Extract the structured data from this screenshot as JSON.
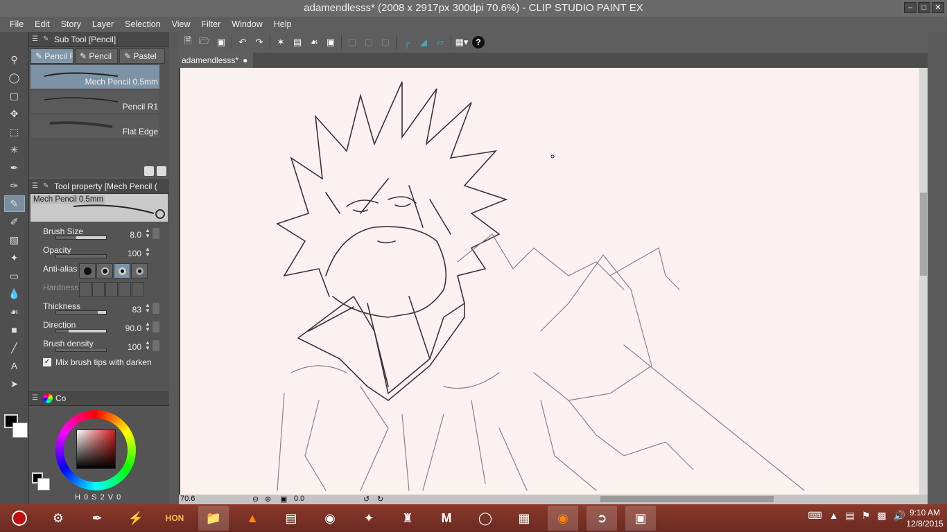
{
  "window": {
    "title": "adamendlesss* (2008 x 2917px 300dpi 70.6%)  - CLIP STUDIO PAINT EX"
  },
  "menu": [
    "File",
    "Edit",
    "Story",
    "Layer",
    "Selection",
    "View",
    "Filter",
    "Window",
    "Help"
  ],
  "subtool": {
    "header": "Sub Tool [Pencil]",
    "tabs": [
      "Pencil F",
      "Pencil",
      "Pastel"
    ],
    "brushes": [
      "Mech Pencil 0.5mm",
      "Pencil R1",
      "Flat Edge"
    ]
  },
  "toolprop": {
    "header": "Tool property [Mech Pencil (",
    "preview_name": "Mech Pencil 0.5mm",
    "brush_size": {
      "label": "Brush Size",
      "value": "8.0",
      "fraction": 0.4
    },
    "opacity": {
      "label": "Opacity",
      "value": "100",
      "fraction": 1.0
    },
    "anti_alias": {
      "label": "Anti-alias"
    },
    "hardness": {
      "label": "Hardness"
    },
    "thickness": {
      "label": "Thickness",
      "value": "83",
      "fraction": 0.83
    },
    "direction": {
      "label": "Direction",
      "value": "90.0",
      "fraction": 0.25
    },
    "brush_density": {
      "label": "Brush density",
      "value": "100",
      "fraction": 1.0
    },
    "mix_tips": {
      "label": "Mix brush tips with darken",
      "checked": true
    }
  },
  "colorpanel": {
    "tab_label": "Co",
    "hsv": {
      "h": "0",
      "s": "2",
      "v": "0"
    }
  },
  "document": {
    "tab": "adamendlesss*"
  },
  "status": {
    "zoom": "70.6",
    "rotation": "0.0"
  },
  "taskbar": {
    "apps": [
      "power-icon",
      "settings-icon",
      "brush-icon",
      "bolt-icon",
      "hon-icon",
      "folder-icon",
      "vlc-icon",
      "network-icon",
      "game-icon",
      "emblem-icon",
      "helmet-icon",
      "m-icon",
      "steam-icon",
      "archive-icon",
      "firefox-icon",
      "clip-studio-icon",
      "photo-icon"
    ],
    "time": "9:10 AM",
    "date": "12/8/2015"
  }
}
